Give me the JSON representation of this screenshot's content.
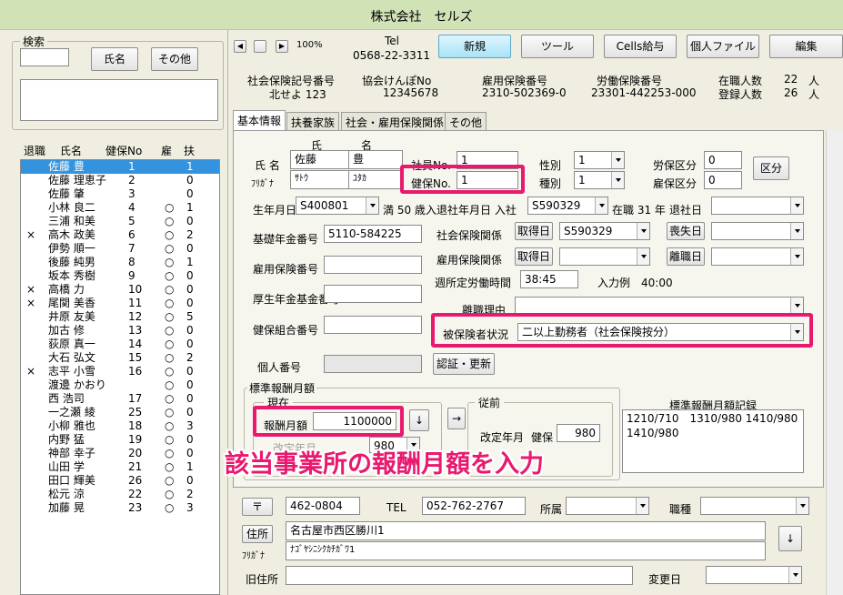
{
  "window": {
    "title": "株式会社　セルズ"
  },
  "search": {
    "group_label": "検索",
    "name_button": "氏名",
    "other_button": "その他"
  },
  "list": {
    "headers": [
      "退職",
      "氏名",
      "健保No",
      "雇",
      "扶"
    ],
    "rows": [
      {
        "ret": "",
        "name": "佐藤 豊",
        "no": "1",
        "emp": "",
        "dep": "1",
        "selected": true
      },
      {
        "ret": "",
        "name": "佐藤 理恵子",
        "no": "2",
        "emp": "",
        "dep": "0"
      },
      {
        "ret": "",
        "name": "佐藤 肇",
        "no": "3",
        "emp": "",
        "dep": "0"
      },
      {
        "ret": "",
        "name": "小林 良二",
        "no": "4",
        "emp": "○",
        "dep": "1"
      },
      {
        "ret": "",
        "name": "三浦 和美",
        "no": "5",
        "emp": "○",
        "dep": "0"
      },
      {
        "ret": "×",
        "name": "高木 政美",
        "no": "6",
        "emp": "○",
        "dep": "2"
      },
      {
        "ret": "",
        "name": "伊勢 順一",
        "no": "7",
        "emp": "○",
        "dep": "0"
      },
      {
        "ret": "",
        "name": "後藤 純男",
        "no": "8",
        "emp": "○",
        "dep": "1"
      },
      {
        "ret": "",
        "name": "坂本 秀樹",
        "no": "9",
        "emp": "○",
        "dep": "0"
      },
      {
        "ret": "×",
        "name": "高橋 力",
        "no": "10",
        "emp": "○",
        "dep": "0"
      },
      {
        "ret": "×",
        "name": "尾関 美香",
        "no": "11",
        "emp": "○",
        "dep": "0"
      },
      {
        "ret": "",
        "name": "井原 友美",
        "no": "12",
        "emp": "○",
        "dep": "5"
      },
      {
        "ret": "",
        "name": "加古 修",
        "no": "13",
        "emp": "○",
        "dep": "0"
      },
      {
        "ret": "",
        "name": "荻原 真一",
        "no": "14",
        "emp": "○",
        "dep": "0"
      },
      {
        "ret": "",
        "name": "大石 弘文",
        "no": "15",
        "emp": "○",
        "dep": "2"
      },
      {
        "ret": "×",
        "name": "志平 小雪",
        "no": "16",
        "emp": "○",
        "dep": "0"
      },
      {
        "ret": "",
        "name": "渡邊 かおり",
        "no": "",
        "emp": "○",
        "dep": "0"
      },
      {
        "ret": "",
        "name": "西 浩司",
        "no": "17",
        "emp": "○",
        "dep": "0"
      },
      {
        "ret": "",
        "name": "一之瀬 綾",
        "no": "25",
        "emp": "○",
        "dep": "0"
      },
      {
        "ret": "",
        "name": "小柳 雅也",
        "no": "18",
        "emp": "○",
        "dep": "3"
      },
      {
        "ret": "",
        "name": "内野 猛",
        "no": "19",
        "emp": "○",
        "dep": "0"
      },
      {
        "ret": "",
        "name": "神部 幸子",
        "no": "20",
        "emp": "○",
        "dep": "0"
      },
      {
        "ret": "",
        "name": "山田 学",
        "no": "21",
        "emp": "○",
        "dep": "1"
      },
      {
        "ret": "",
        "name": "田口 輝美",
        "no": "26",
        "emp": "○",
        "dep": "0"
      },
      {
        "ret": "",
        "name": "松元 涼",
        "no": "22",
        "emp": "○",
        "dep": "2"
      },
      {
        "ret": "",
        "name": "加藤 晃",
        "no": "23",
        "emp": "○",
        "dep": "3"
      }
    ]
  },
  "toolbar": {
    "zoom": "100%",
    "tel_label": "Tel",
    "tel_value": "0568-22-3311",
    "new": "新規",
    "tools": "ツール",
    "cells": "Cells給与",
    "personal_file": "個人ファイル",
    "edit": "編集"
  },
  "company": {
    "shaho_label": "社会保険記号番号",
    "shaho_value": "北せよ 123",
    "kyokai_label": "協会けんぽNo",
    "kyokai_value": "12345678",
    "koyo_label": "雇用保険番号",
    "koyo_value": "2310-502369-0",
    "rodo_label": "労働保険番号",
    "rodo_value": "23301-442253-000",
    "zaishoku_label": "在職人数",
    "zaishoku_value": "22",
    "toroku_label": "登録人数",
    "toroku_value": "26",
    "unit": "人"
  },
  "tabs": [
    "基本情報",
    "扶養家族",
    "社会・雇用保険関係",
    "その他"
  ],
  "form": {
    "sei_header": "氏",
    "mei_header": "名",
    "name_label": "氏 名",
    "sei": "佐藤",
    "mei": "豊",
    "furigana_label": "ﾌﾘｶﾞﾅ",
    "sei_kana": "ｻﾄｳ",
    "mei_kana": "ﾕﾀｶ",
    "shain_no_label": "社員No.",
    "shain_no": "1",
    "kenpo_no_label": "健保No.",
    "kenpo_no": "1",
    "sex_label": "性別",
    "sex": "1",
    "type_label": "種別",
    "type": "1",
    "roho_label": "労保区分",
    "roho": "0",
    "koho_label": "雇保区分",
    "koho": "0",
    "kubun_button": "区分",
    "birth_label": "生年月日",
    "birth": "S400801",
    "age": "満 50 歳",
    "join_label": "入退社年月日 入社",
    "join": "S590329",
    "tenure": "在職 31 年",
    "leave_label": "退社日",
    "leave": "",
    "pension_label": "基礎年金番号",
    "pension": "5110-584225",
    "shaho_rel_label": "社会保険関係",
    "shutoku_button": "取得日",
    "shutoku": "S590329",
    "soshitsu_button": "喪失日",
    "soshitsu": "",
    "koyo_no_label": "雇用保険番号",
    "koyo_no": "",
    "koyo_rel_label": "雇用保険関係",
    "koyo_shutoku_button": "取得日",
    "koyo_shutoku": "",
    "rishoku_button": "離職日",
    "rishoku": "",
    "hours_label": "週所定労働時間",
    "hours": "38:45",
    "example": "入力例　40:00",
    "kosei_label": "厚生年金基金番号",
    "kosei": "",
    "riyu_label": "離職理由",
    "riyu": "",
    "kumiai_label": "健保組合番号",
    "kumiai": "",
    "hihoken_label": "被保険者状況",
    "hihoken": "二以上勤務者（社会保険按分）",
    "kojin_label": "個人番号",
    "ninsho_button": "認証・更新"
  },
  "salary": {
    "group_label": "標準報酬月額",
    "current_label": "現在",
    "monthly_label": "報酬月額",
    "monthly_value": "1100000",
    "kaitei_label": "改定年月",
    "kaitei_value": "980",
    "arrow": "→",
    "down": "↓",
    "previous_label": "従前",
    "prev_kaitei_label": "改定年月",
    "prev_kenpo_label": "健保",
    "prev_kenpo_value": "980",
    "record_label": "標準報酬月額記録",
    "record_text": "1210/710　1310/980 1410/980\n1410/980"
  },
  "annotation": "該当事業所の報酬月額を入力",
  "address": {
    "postal_button": "〒",
    "postal": "462-0804",
    "tel_label": "TEL",
    "tel": "052-762-2767",
    "shozoku_label": "所属",
    "shozoku": "",
    "shokushu_label": "職種",
    "shokushu": "",
    "address_button": "住所",
    "address": "名古屋市西区勝川1",
    "furigana_label": "ﾌﾘｶﾞﾅ",
    "address_kana": "ﾅｺﾞﾔｼﾆｼｸｶﾁｶﾞﾜ1",
    "down": "↓",
    "old_label": "旧住所",
    "old": "",
    "change_label": "変更日",
    "change": ""
  },
  "colors": {
    "highlight": "#e8196e",
    "selected_row": "#3393df",
    "titlebar": "#d2e2b7"
  }
}
